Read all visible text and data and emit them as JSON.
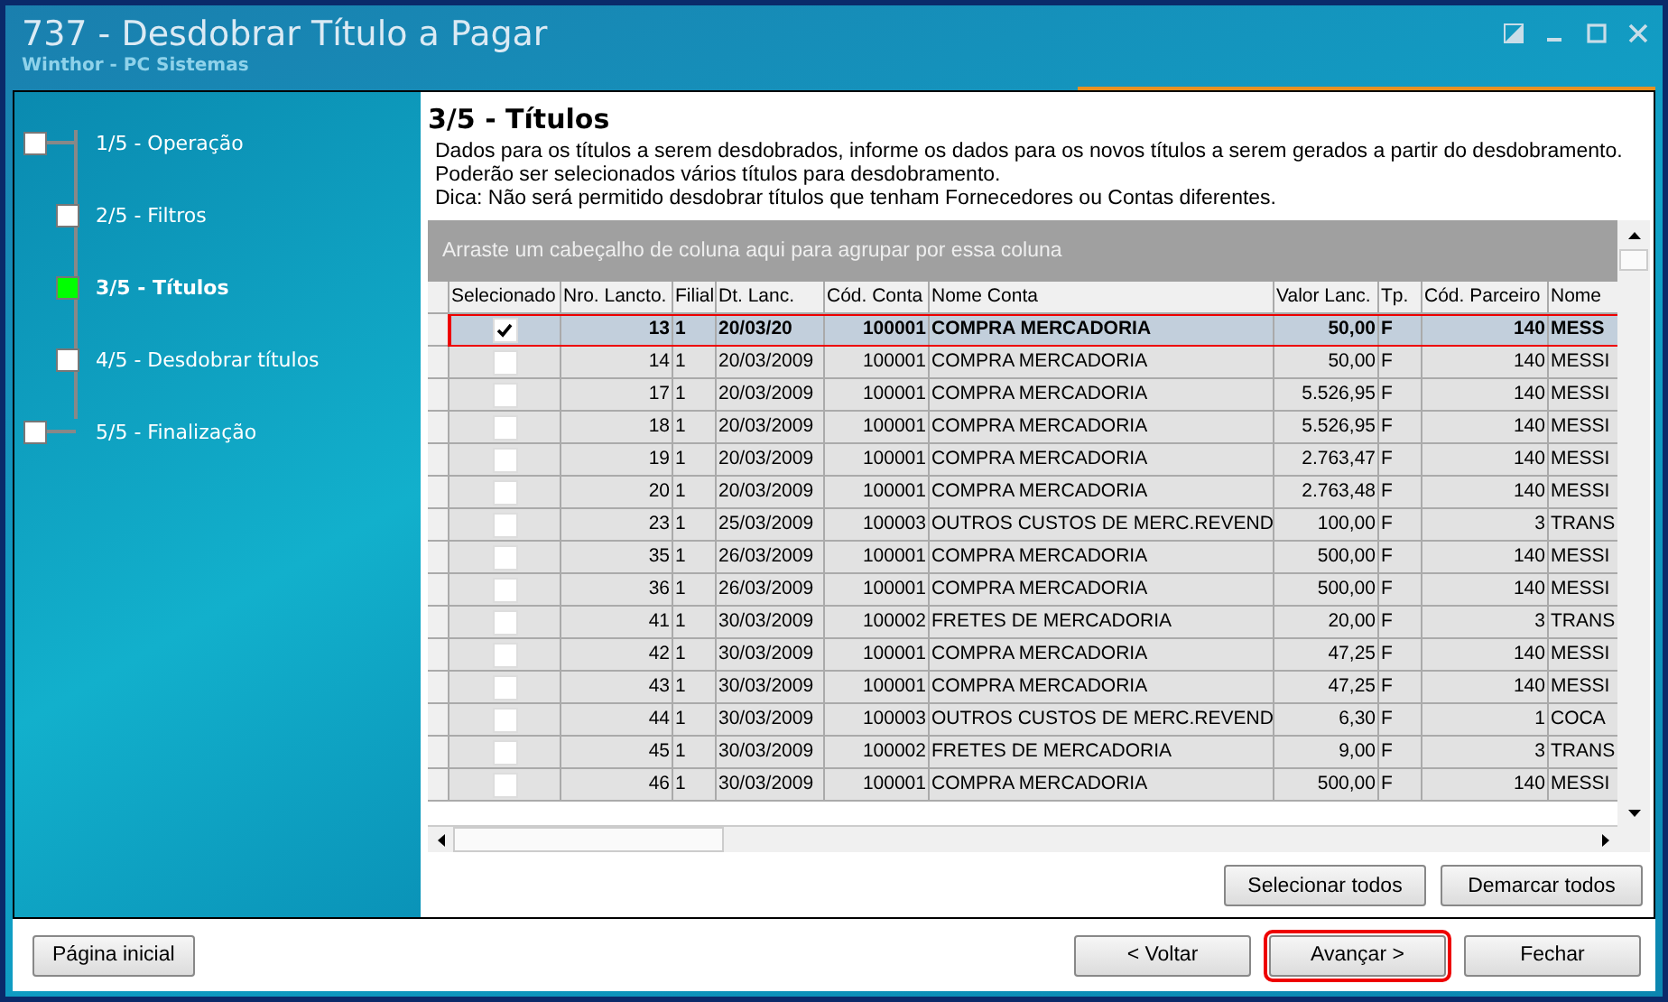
{
  "window": {
    "title": "737 - Desdobrar Título a Pagar",
    "subtitle": "Winthor - PC Sistemas"
  },
  "steps": [
    {
      "label": "1/5 - Operação",
      "kind": "outer",
      "selected": false
    },
    {
      "label": "2/5 - Filtros",
      "kind": "inner",
      "selected": false
    },
    {
      "label": "3/5 - Títulos",
      "kind": "inner",
      "selected": true
    },
    {
      "label": "4/5 - Desdobrar títulos",
      "kind": "inner",
      "selected": false
    },
    {
      "label": "5/5 - Finalização",
      "kind": "outer",
      "selected": false
    }
  ],
  "page": {
    "title": "3/5 - Títulos",
    "description": [
      "Dados para os títulos a serem desdobrados, informe os dados para os novos títulos a serem gerados a partir do desdobramento.",
      "Poderão ser selecionados vários títulos para desdobramento.",
      "Dica: Não será permitido desdobrar títulos que tenham Fornecedores ou Contas diferentes."
    ]
  },
  "table": {
    "group_hint": "Arraste um cabeçalho de coluna aqui para agrupar por essa coluna",
    "checkbox_column": "Selecionado",
    "columns": [
      "Nro. Lancto.",
      "Filial",
      "Dt. Lanc.",
      "Cód. Conta",
      "Nome Conta",
      "Valor Lanc.",
      "Tp.",
      "Cód. Parceiro",
      "Nome"
    ],
    "rows": [
      {
        "selected": true,
        "annotated": true,
        "checked": true,
        "cells": [
          "13",
          "1",
          "20/03/20",
          "100001",
          "COMPRA MERCADORIA",
          "50,00",
          "F",
          "140",
          "MESS"
        ]
      },
      {
        "selected": false,
        "annotated": false,
        "checked": false,
        "cells": [
          "14",
          "1",
          "20/03/2009",
          "100001",
          "COMPRA MERCADORIA",
          "50,00",
          "F",
          "140",
          "MESSI"
        ]
      },
      {
        "selected": false,
        "annotated": false,
        "checked": false,
        "cells": [
          "17",
          "1",
          "20/03/2009",
          "100001",
          "COMPRA MERCADORIA",
          "5.526,95",
          "F",
          "140",
          "MESSI"
        ]
      },
      {
        "selected": false,
        "annotated": false,
        "checked": false,
        "cells": [
          "18",
          "1",
          "20/03/2009",
          "100001",
          "COMPRA MERCADORIA",
          "5.526,95",
          "F",
          "140",
          "MESSI"
        ]
      },
      {
        "selected": false,
        "annotated": false,
        "checked": false,
        "cells": [
          "19",
          "1",
          "20/03/2009",
          "100001",
          "COMPRA MERCADORIA",
          "2.763,47",
          "F",
          "140",
          "MESSI"
        ]
      },
      {
        "selected": false,
        "annotated": false,
        "checked": false,
        "cells": [
          "20",
          "1",
          "20/03/2009",
          "100001",
          "COMPRA MERCADORIA",
          "2.763,48",
          "F",
          "140",
          "MESSI"
        ]
      },
      {
        "selected": false,
        "annotated": false,
        "checked": false,
        "cells": [
          "23",
          "1",
          "25/03/2009",
          "100003",
          "OUTROS CUSTOS DE MERC.REVEND",
          "100,00",
          "F",
          "3",
          "TRANS"
        ]
      },
      {
        "selected": false,
        "annotated": false,
        "checked": false,
        "cells": [
          "35",
          "1",
          "26/03/2009",
          "100001",
          "COMPRA MERCADORIA",
          "500,00",
          "F",
          "140",
          "MESSI"
        ]
      },
      {
        "selected": false,
        "annotated": false,
        "checked": false,
        "cells": [
          "36",
          "1",
          "26/03/2009",
          "100001",
          "COMPRA MERCADORIA",
          "500,00",
          "F",
          "140",
          "MESSI"
        ]
      },
      {
        "selected": false,
        "annotated": false,
        "checked": false,
        "cells": [
          "41",
          "1",
          "30/03/2009",
          "100002",
          "FRETES DE MERCADORIA",
          "20,00",
          "F",
          "3",
          "TRANS"
        ]
      },
      {
        "selected": false,
        "annotated": false,
        "checked": false,
        "cells": [
          "42",
          "1",
          "30/03/2009",
          "100001",
          "COMPRA MERCADORIA",
          "47,25",
          "F",
          "140",
          "MESSI"
        ]
      },
      {
        "selected": false,
        "annotated": false,
        "checked": false,
        "cells": [
          "43",
          "1",
          "30/03/2009",
          "100001",
          "COMPRA MERCADORIA",
          "47,25",
          "F",
          "140",
          "MESSI"
        ]
      },
      {
        "selected": false,
        "annotated": false,
        "checked": false,
        "cells": [
          "44",
          "1",
          "30/03/2009",
          "100003",
          "OUTROS CUSTOS DE MERC.REVEND",
          "6,30",
          "F",
          "1",
          "COCA"
        ]
      },
      {
        "selected": false,
        "annotated": false,
        "checked": false,
        "cells": [
          "45",
          "1",
          "30/03/2009",
          "100002",
          "FRETES DE MERCADORIA",
          "9,00",
          "F",
          "3",
          "TRANS"
        ]
      },
      {
        "selected": false,
        "annotated": false,
        "checked": false,
        "cells": [
          "46",
          "1",
          "30/03/2009",
          "100001",
          "COMPRA MERCADORIA",
          "500,00",
          "F",
          "140",
          "MESSI"
        ]
      }
    ]
  },
  "grid_buttons": [
    {
      "label": "Selecionar todos"
    },
    {
      "label": "Demarcar todos"
    }
  ],
  "footer": {
    "left_button": "Página inicial",
    "buttons": [
      {
        "label": "< Voltar",
        "annotated": false
      },
      {
        "label": "Avançar >",
        "annotated": true
      },
      {
        "label": "Fechar",
        "annotated": false
      }
    ]
  }
}
